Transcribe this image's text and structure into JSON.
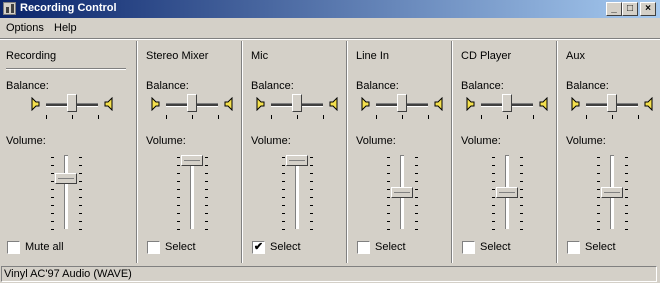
{
  "window": {
    "title": "Recording Control",
    "minimize": "_",
    "maximize": "□",
    "close": "×"
  },
  "menu": [
    "Options",
    "Help"
  ],
  "master": {
    "title": "Recording",
    "balance_label": "Balance:",
    "volume_label": "Volume:",
    "checkbox_label": "Mute all",
    "checked": false,
    "balance": 0.5,
    "volume": 0.72
  },
  "channels": [
    {
      "name": "Stereo Mixer",
      "balance_label": "Balance:",
      "volume_label": "Volume:",
      "checkbox_label": "Select",
      "checked": false,
      "balance": 0.5,
      "volume": 1.0
    },
    {
      "name": "Mic",
      "balance_label": "Balance:",
      "volume_label": "Volume:",
      "checkbox_label": "Select",
      "checked": true,
      "balance": 0.5,
      "volume": 1.0
    },
    {
      "name": "Line In",
      "balance_label": "Balance:",
      "volume_label": "Volume:",
      "checkbox_label": "Select",
      "checked": false,
      "balance": 0.5,
      "volume": 0.5
    },
    {
      "name": "CD Player",
      "balance_label": "Balance:",
      "volume_label": "Volume:",
      "checkbox_label": "Select",
      "checked": false,
      "balance": 0.5,
      "volume": 0.5
    },
    {
      "name": "Aux",
      "balance_label": "Balance:",
      "volume_label": "Volume:",
      "checkbox_label": "Select",
      "checked": false,
      "balance": 0.5,
      "volume": 0.5
    }
  ],
  "status_bar": "Vinyl AC'97 Audio (WAVE)",
  "icons": {
    "left_speaker": "speaker-left-icon",
    "right_speaker": "speaker-right-icon",
    "app": "mixer-icon",
    "check": "✔"
  }
}
